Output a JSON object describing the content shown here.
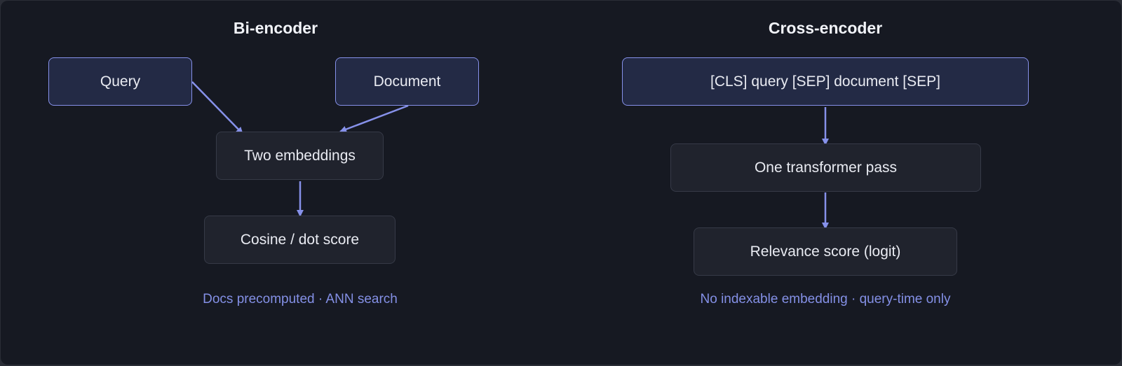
{
  "bi_encoder": {
    "title": "Bi-encoder",
    "query": "Query",
    "document": "Document",
    "embeddings": "Two embeddings",
    "score": "Cosine / dot score",
    "note": "Docs precomputed · ANN search"
  },
  "cross_encoder": {
    "title": "Cross-encoder",
    "input": "[CLS] query [SEP] document [SEP]",
    "pass": "One transformer pass",
    "score": "Relevance score (logit)",
    "note": "No indexable embedding · query-time only"
  },
  "colors": {
    "accent": "#8691ea",
    "background": "#161922",
    "input_fill": "#232a45",
    "step_fill": "#20232d"
  }
}
